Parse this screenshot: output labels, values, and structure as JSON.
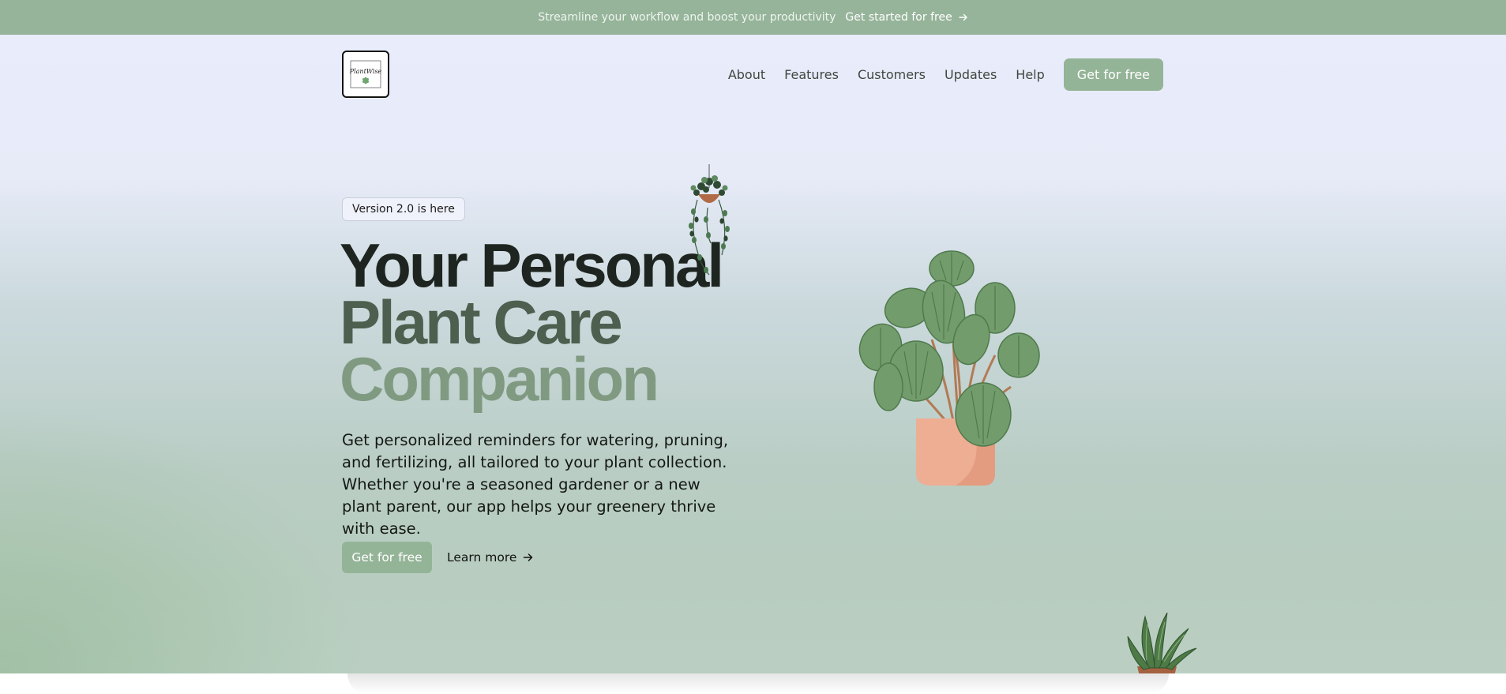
{
  "announcement": {
    "text": "Streamline your workflow and boost your productivity",
    "cta_label": "Get started for free",
    "cta_icon": "arrow-right-icon"
  },
  "brand": {
    "logo_text": "PlantWise",
    "logo_icon": "leaf-icon"
  },
  "nav": {
    "links": [
      "About",
      "Features",
      "Customers",
      "Updates",
      "Help"
    ],
    "cta_label": "Get for free"
  },
  "hero": {
    "badge": "Version 2.0 is here",
    "headline_line1": "Your Personal",
    "headline_line2": "Plant Care",
    "headline_line3": "Companion",
    "description": "Get personalized reminders for watering, pruning, and fertilizing, all tailored to your plant collection. Whether you're a seasoned gardener or a new plant parent, our app helps your greenery thrive with ease.",
    "primary_cta": "Get for free",
    "secondary_cta": "Learn more",
    "secondary_icon": "arrow-right-icon",
    "illustrations": [
      "hanging-plant-illustration",
      "potted-peperomia-illustration",
      "snake-plant-illustration"
    ]
  },
  "colors": {
    "accent": "#94b497",
    "topbar": "#96b49a",
    "headline_dark": "#1e2520",
    "headline_mid": "#4d5f4e",
    "headline_light": "#809a82",
    "pot": "#eeae94"
  }
}
